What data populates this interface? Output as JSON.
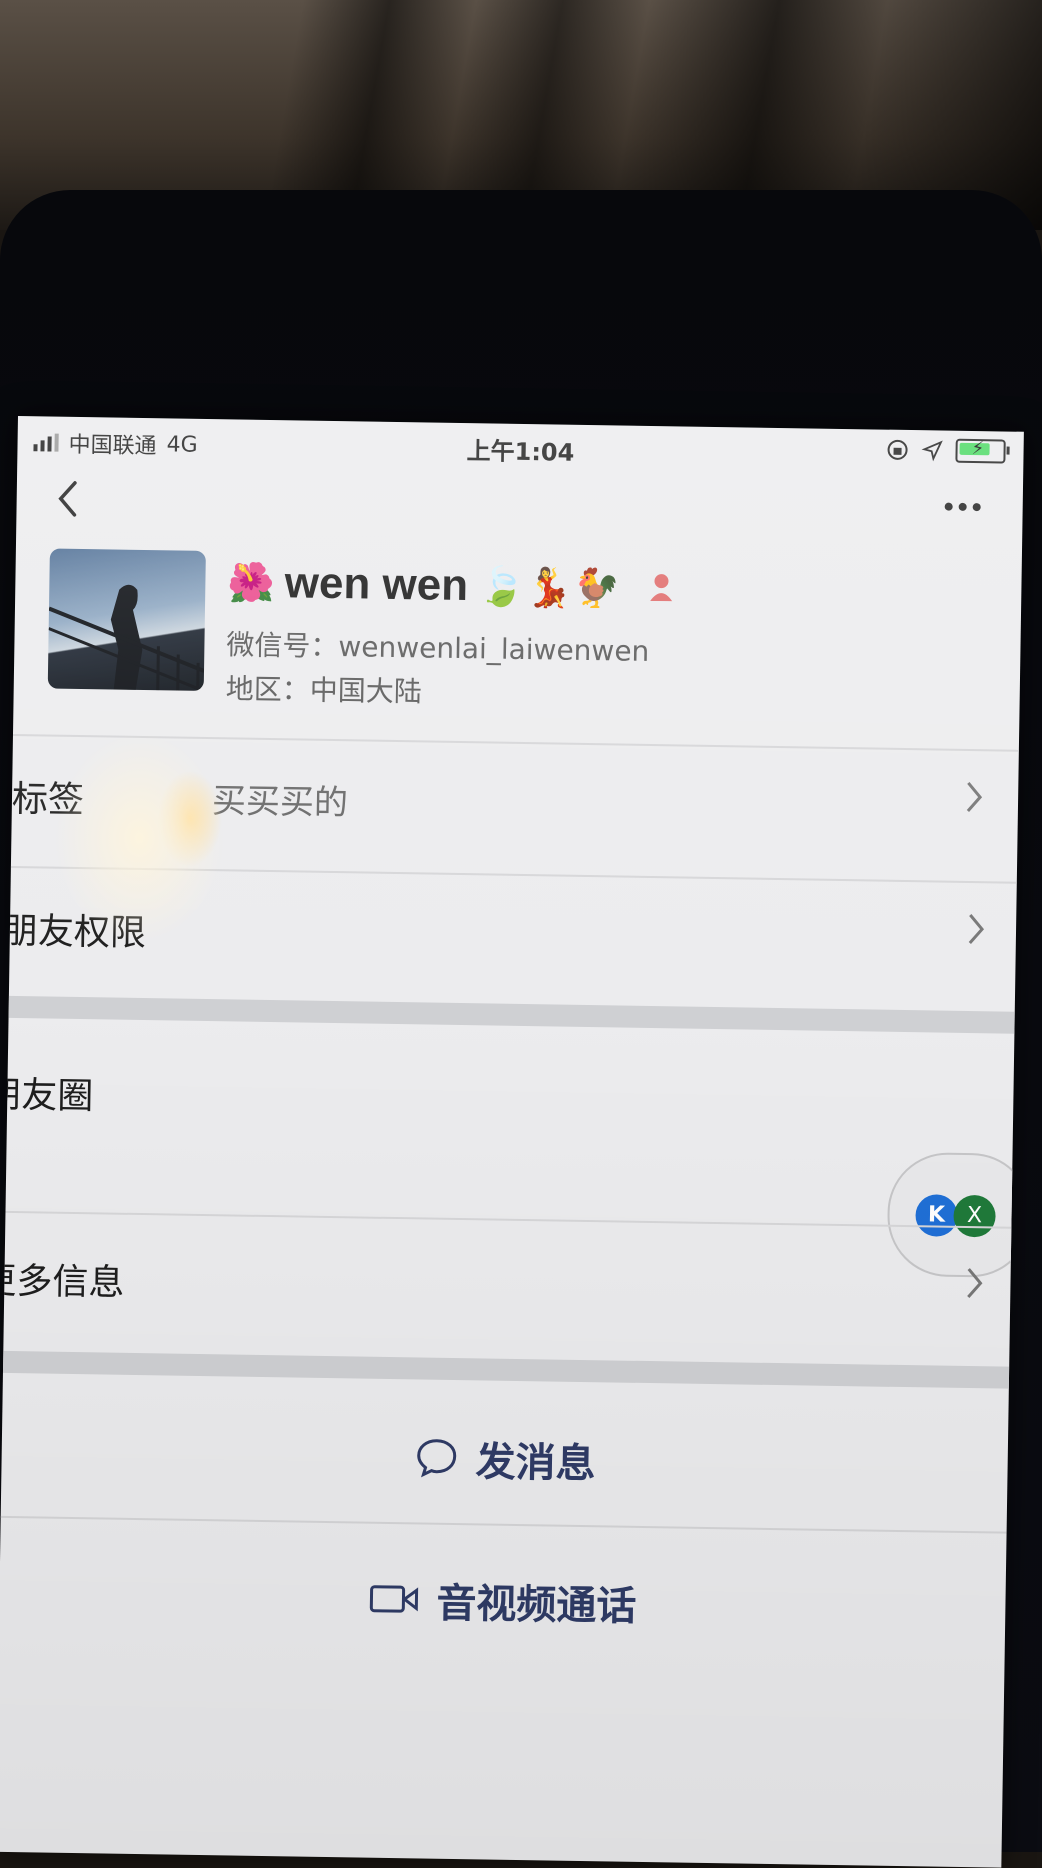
{
  "status_bar": {
    "carrier": "中国联通",
    "network": "4G",
    "time": "上午1:04"
  },
  "nav": {
    "back_icon": "chevron-left-icon",
    "more_icon": "more-dots-icon"
  },
  "profile": {
    "name": "wen wen",
    "name_emoji_prefix": "🌺",
    "name_emoji_suffix": "🍃💃🐓",
    "wechat_id": "微信号：wenwenlai_laiwenwen",
    "region": "地区：中国大陆"
  },
  "rows": {
    "tags_label": "标签",
    "tags_value": "买买买的",
    "friend_permissions": "朋友权限",
    "moments": "朋友圈",
    "more_info": "更多信息"
  },
  "float": {
    "badge_a": "K",
    "badge_b": "X"
  },
  "actions": {
    "message": "发消息",
    "call": "音视频通话"
  },
  "colors": {
    "action_text": "#2f3b66",
    "background": "#ececee"
  }
}
